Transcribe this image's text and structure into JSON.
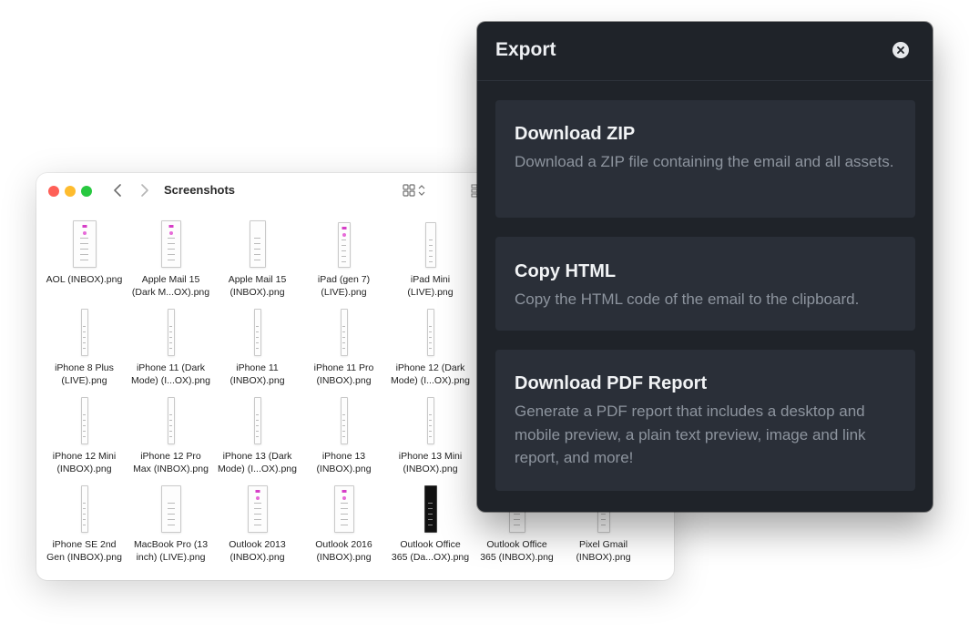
{
  "finder": {
    "title": "Screenshots",
    "files": [
      {
        "line1": "AOL (INBOX).png",
        "line2": ""
      },
      {
        "line1": "Apple Mail 15",
        "line2": "(Dark M...OX).png"
      },
      {
        "line1": "Apple Mail 15",
        "line2": "(INBOX).png"
      },
      {
        "line1": "iPad (gen 7)",
        "line2": "(LIVE).png"
      },
      {
        "line1": "iPad Mini",
        "line2": "(LIVE).png"
      },
      {
        "line1": "iPhone 8 Plus",
        "line2": "(LIVE).png"
      },
      {
        "line1": "iPhone 11 (Dark",
        "line2": "Mode) (I...OX).png"
      },
      {
        "line1": "iPhone 11",
        "line2": "(INBOX).png"
      },
      {
        "line1": "iPhone 11 Pro",
        "line2": "(INBOX).png"
      },
      {
        "line1": "iPhone 12 (Dark",
        "line2": "Mode) (I...OX).png"
      },
      {
        "line1": "iPhone 12 Mini",
        "line2": "(INBOX).png"
      },
      {
        "line1": "iPhone 12 Pro",
        "line2": "Max (INBOX).png"
      },
      {
        "line1": "iPhone 13 (Dark",
        "line2": "Mode) (I...OX).png"
      },
      {
        "line1": "iPhone 13",
        "line2": "(INBOX).png"
      },
      {
        "line1": "iPhone 13 Mini",
        "line2": "(INBOX).png"
      },
      {
        "line1": "iPhone SE 2nd",
        "line2": "Gen (INBOX).png"
      },
      {
        "line1": "MacBook Pro (13",
        "line2": "inch) (LIVE).png"
      },
      {
        "line1": "Outlook 2013",
        "line2": "(INBOX).png"
      },
      {
        "line1": "Outlook 2016",
        "line2": "(INBOX).png"
      },
      {
        "line1": "Outlook Office",
        "line2": "365 (Da...OX).png"
      },
      {
        "line1": "Outlook Office",
        "line2": "365 (INBOX).png"
      },
      {
        "line1": "Pixel Gmail",
        "line2": "(INBOX).png"
      }
    ]
  },
  "dialog": {
    "title": "Export",
    "options": [
      {
        "title": "Download ZIP",
        "description": "Download a ZIP file containing the email and all assets."
      },
      {
        "title": "Copy HTML",
        "description": "Copy the HTML code of the email to the clipboard."
      },
      {
        "title": "Download PDF Report",
        "description": "Generate a PDF report that includes a desktop and mobile preview, a plain text preview, image and link report, and more!"
      }
    ]
  },
  "icons": {
    "close": "close-circle-icon",
    "back": "chevron-left-icon",
    "forward": "chevron-right-icon",
    "view": "grid-view-icon"
  },
  "colors": {
    "dialog_bg": "#1f2329",
    "card_bg": "#2a2f38",
    "accent_pink": "#d63ec7"
  }
}
